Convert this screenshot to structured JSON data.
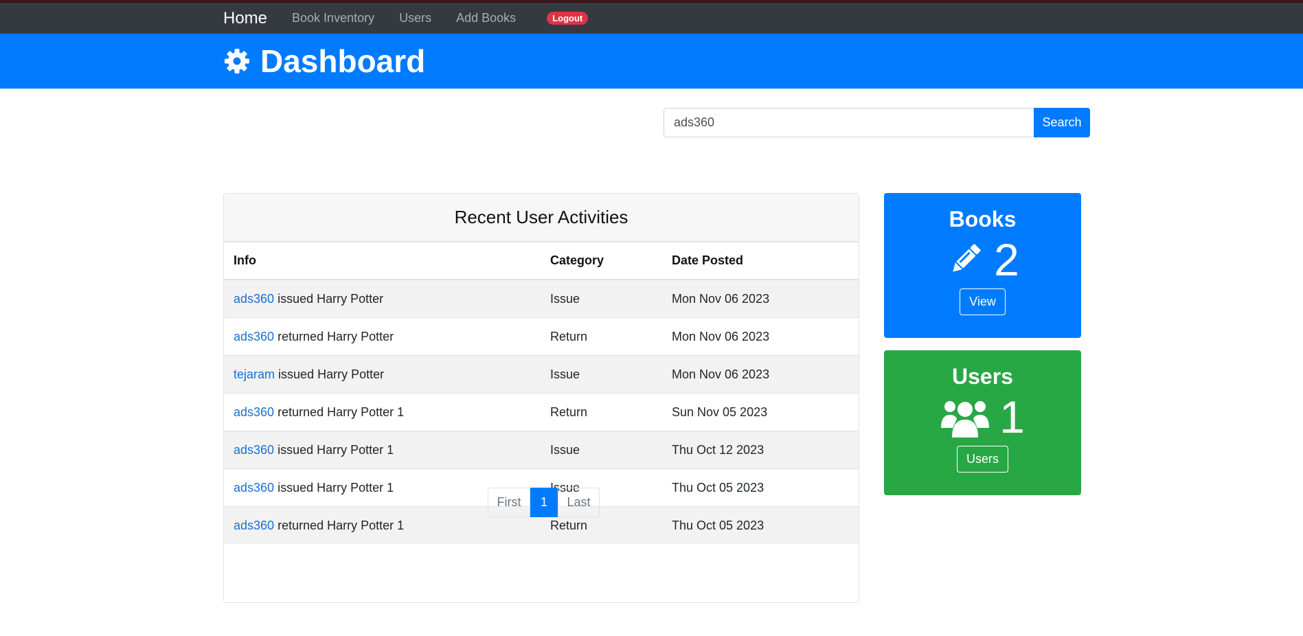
{
  "nav": {
    "brand": "Home",
    "links": [
      "Book Inventory",
      "Users",
      "Add Books"
    ],
    "logout": "Logout"
  },
  "header": {
    "title": "Dashboard",
    "icon": "gear-icon"
  },
  "search": {
    "value": "ads360",
    "button": "Search"
  },
  "activities": {
    "title": "Recent User Activities",
    "columns": [
      "Info",
      "Category",
      "Date Posted"
    ],
    "rows": [
      {
        "user": "ads360",
        "action": "issued Harry Potter",
        "category": "Issue",
        "date": "Mon Nov 06 2023"
      },
      {
        "user": "ads360",
        "action": "returned Harry Potter",
        "category": "Return",
        "date": "Mon Nov 06 2023"
      },
      {
        "user": "tejaram",
        "action": "issued Harry Potter",
        "category": "Issue",
        "date": "Mon Nov 06 2023"
      },
      {
        "user": "ads360",
        "action": "returned Harry Potter 1",
        "category": "Return",
        "date": "Sun Nov 05 2023"
      },
      {
        "user": "ads360",
        "action": "issued Harry Potter 1",
        "category": "Issue",
        "date": "Thu Oct 12 2023"
      },
      {
        "user": "ads360",
        "action": "issued Harry Potter 1",
        "category": "Issue",
        "date": "Thu Oct 05 2023"
      },
      {
        "user": "ads360",
        "action": "returned Harry Potter 1",
        "category": "Return",
        "date": "Thu Oct 05 2023"
      }
    ],
    "pagination": {
      "first": "First",
      "current": "1",
      "last": "Last"
    }
  },
  "books_card": {
    "title": "Books",
    "count": "2",
    "button": "View",
    "icon": "pencil-icon",
    "color": "#007bff"
  },
  "users_card": {
    "title": "Users",
    "count": "1",
    "button": "Users",
    "icon": "users-icon",
    "color": "#28a745"
  }
}
